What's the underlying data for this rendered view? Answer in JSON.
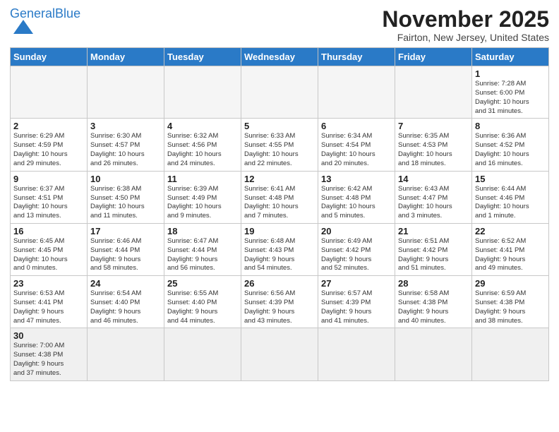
{
  "logo": {
    "line1": "General",
    "line2": "Blue"
  },
  "title": "November 2025",
  "subtitle": "Fairton, New Jersey, United States",
  "weekdays": [
    "Sunday",
    "Monday",
    "Tuesday",
    "Wednesday",
    "Thursday",
    "Friday",
    "Saturday"
  ],
  "weeks": [
    [
      {
        "num": "",
        "info": ""
      },
      {
        "num": "",
        "info": ""
      },
      {
        "num": "",
        "info": ""
      },
      {
        "num": "",
        "info": ""
      },
      {
        "num": "",
        "info": ""
      },
      {
        "num": "",
        "info": ""
      },
      {
        "num": "1",
        "info": "Sunrise: 7:28 AM\nSunset: 6:00 PM\nDaylight: 10 hours\nand 31 minutes."
      }
    ],
    [
      {
        "num": "2",
        "info": "Sunrise: 6:29 AM\nSunset: 4:59 PM\nDaylight: 10 hours\nand 29 minutes."
      },
      {
        "num": "3",
        "info": "Sunrise: 6:30 AM\nSunset: 4:57 PM\nDaylight: 10 hours\nand 26 minutes."
      },
      {
        "num": "4",
        "info": "Sunrise: 6:32 AM\nSunset: 4:56 PM\nDaylight: 10 hours\nand 24 minutes."
      },
      {
        "num": "5",
        "info": "Sunrise: 6:33 AM\nSunset: 4:55 PM\nDaylight: 10 hours\nand 22 minutes."
      },
      {
        "num": "6",
        "info": "Sunrise: 6:34 AM\nSunset: 4:54 PM\nDaylight: 10 hours\nand 20 minutes."
      },
      {
        "num": "7",
        "info": "Sunrise: 6:35 AM\nSunset: 4:53 PM\nDaylight: 10 hours\nand 18 minutes."
      },
      {
        "num": "8",
        "info": "Sunrise: 6:36 AM\nSunset: 4:52 PM\nDaylight: 10 hours\nand 16 minutes."
      }
    ],
    [
      {
        "num": "9",
        "info": "Sunrise: 6:37 AM\nSunset: 4:51 PM\nDaylight: 10 hours\nand 13 minutes."
      },
      {
        "num": "10",
        "info": "Sunrise: 6:38 AM\nSunset: 4:50 PM\nDaylight: 10 hours\nand 11 minutes."
      },
      {
        "num": "11",
        "info": "Sunrise: 6:39 AM\nSunset: 4:49 PM\nDaylight: 10 hours\nand 9 minutes."
      },
      {
        "num": "12",
        "info": "Sunrise: 6:41 AM\nSunset: 4:48 PM\nDaylight: 10 hours\nand 7 minutes."
      },
      {
        "num": "13",
        "info": "Sunrise: 6:42 AM\nSunset: 4:48 PM\nDaylight: 10 hours\nand 5 minutes."
      },
      {
        "num": "14",
        "info": "Sunrise: 6:43 AM\nSunset: 4:47 PM\nDaylight: 10 hours\nand 3 minutes."
      },
      {
        "num": "15",
        "info": "Sunrise: 6:44 AM\nSunset: 4:46 PM\nDaylight: 10 hours\nand 1 minute."
      }
    ],
    [
      {
        "num": "16",
        "info": "Sunrise: 6:45 AM\nSunset: 4:45 PM\nDaylight: 10 hours\nand 0 minutes."
      },
      {
        "num": "17",
        "info": "Sunrise: 6:46 AM\nSunset: 4:44 PM\nDaylight: 9 hours\nand 58 minutes."
      },
      {
        "num": "18",
        "info": "Sunrise: 6:47 AM\nSunset: 4:44 PM\nDaylight: 9 hours\nand 56 minutes."
      },
      {
        "num": "19",
        "info": "Sunrise: 6:48 AM\nSunset: 4:43 PM\nDaylight: 9 hours\nand 54 minutes."
      },
      {
        "num": "20",
        "info": "Sunrise: 6:49 AM\nSunset: 4:42 PM\nDaylight: 9 hours\nand 52 minutes."
      },
      {
        "num": "21",
        "info": "Sunrise: 6:51 AM\nSunset: 4:42 PM\nDaylight: 9 hours\nand 51 minutes."
      },
      {
        "num": "22",
        "info": "Sunrise: 6:52 AM\nSunset: 4:41 PM\nDaylight: 9 hours\nand 49 minutes."
      }
    ],
    [
      {
        "num": "23",
        "info": "Sunrise: 6:53 AM\nSunset: 4:41 PM\nDaylight: 9 hours\nand 47 minutes."
      },
      {
        "num": "24",
        "info": "Sunrise: 6:54 AM\nSunset: 4:40 PM\nDaylight: 9 hours\nand 46 minutes."
      },
      {
        "num": "25",
        "info": "Sunrise: 6:55 AM\nSunset: 4:40 PM\nDaylight: 9 hours\nand 44 minutes."
      },
      {
        "num": "26",
        "info": "Sunrise: 6:56 AM\nSunset: 4:39 PM\nDaylight: 9 hours\nand 43 minutes."
      },
      {
        "num": "27",
        "info": "Sunrise: 6:57 AM\nSunset: 4:39 PM\nDaylight: 9 hours\nand 41 minutes."
      },
      {
        "num": "28",
        "info": "Sunrise: 6:58 AM\nSunset: 4:38 PM\nDaylight: 9 hours\nand 40 minutes."
      },
      {
        "num": "29",
        "info": "Sunrise: 6:59 AM\nSunset: 4:38 PM\nDaylight: 9 hours\nand 38 minutes."
      }
    ],
    [
      {
        "num": "30",
        "info": "Sunrise: 7:00 AM\nSunset: 4:38 PM\nDaylight: 9 hours\nand 37 minutes."
      },
      {
        "num": "",
        "info": ""
      },
      {
        "num": "",
        "info": ""
      },
      {
        "num": "",
        "info": ""
      },
      {
        "num": "",
        "info": ""
      },
      {
        "num": "",
        "info": ""
      },
      {
        "num": "",
        "info": ""
      }
    ]
  ]
}
